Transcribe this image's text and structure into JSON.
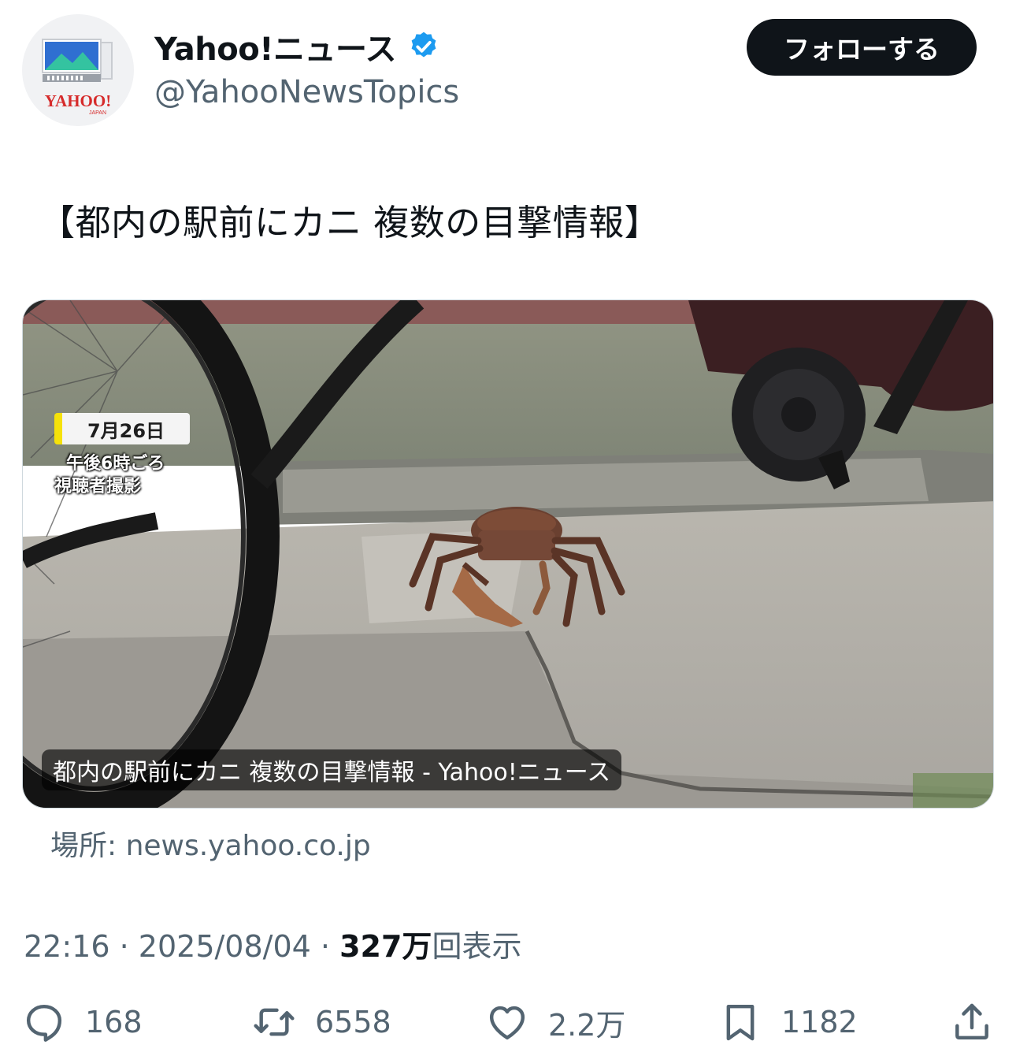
{
  "account": {
    "display_name": "Yahoo!ニュース",
    "handle": "@YahooNewsTopics",
    "verified": true,
    "avatar_logo_text": "YAHOO!",
    "avatar_logo_subtext": "JAPAN"
  },
  "follow_button": {
    "label": "フォローする"
  },
  "tweet": {
    "text": "【都内の駅前にカニ 複数の目撃情報】"
  },
  "media": {
    "overlay_date": "7月26日",
    "overlay_time": "午後6時ごろ",
    "overlay_source": "視聴者撮影",
    "caption": "都内の駅前にカニ 複数の目撃情報 - Yahoo!ニュース"
  },
  "link_source": "場所: news.yahoo.co.jp",
  "meta": {
    "time": "22:16",
    "date": "2025/08/04",
    "separator": "·",
    "views_count": "327万",
    "views_label": "回表示"
  },
  "actions": {
    "reply_count": "168",
    "retweet_count": "6558",
    "like_count": "2.2万",
    "bookmark_count": "1182"
  },
  "colors": {
    "text_primary": "#0f1419",
    "text_secondary": "#536471",
    "verified_blue": "#1d9bf0",
    "follow_button_bg": "#0f1419",
    "yahoo_red": "#d62b2b"
  },
  "icons": [
    "reply-icon",
    "retweet-icon",
    "like-icon",
    "bookmark-icon",
    "share-icon",
    "verified-badge-icon"
  ]
}
